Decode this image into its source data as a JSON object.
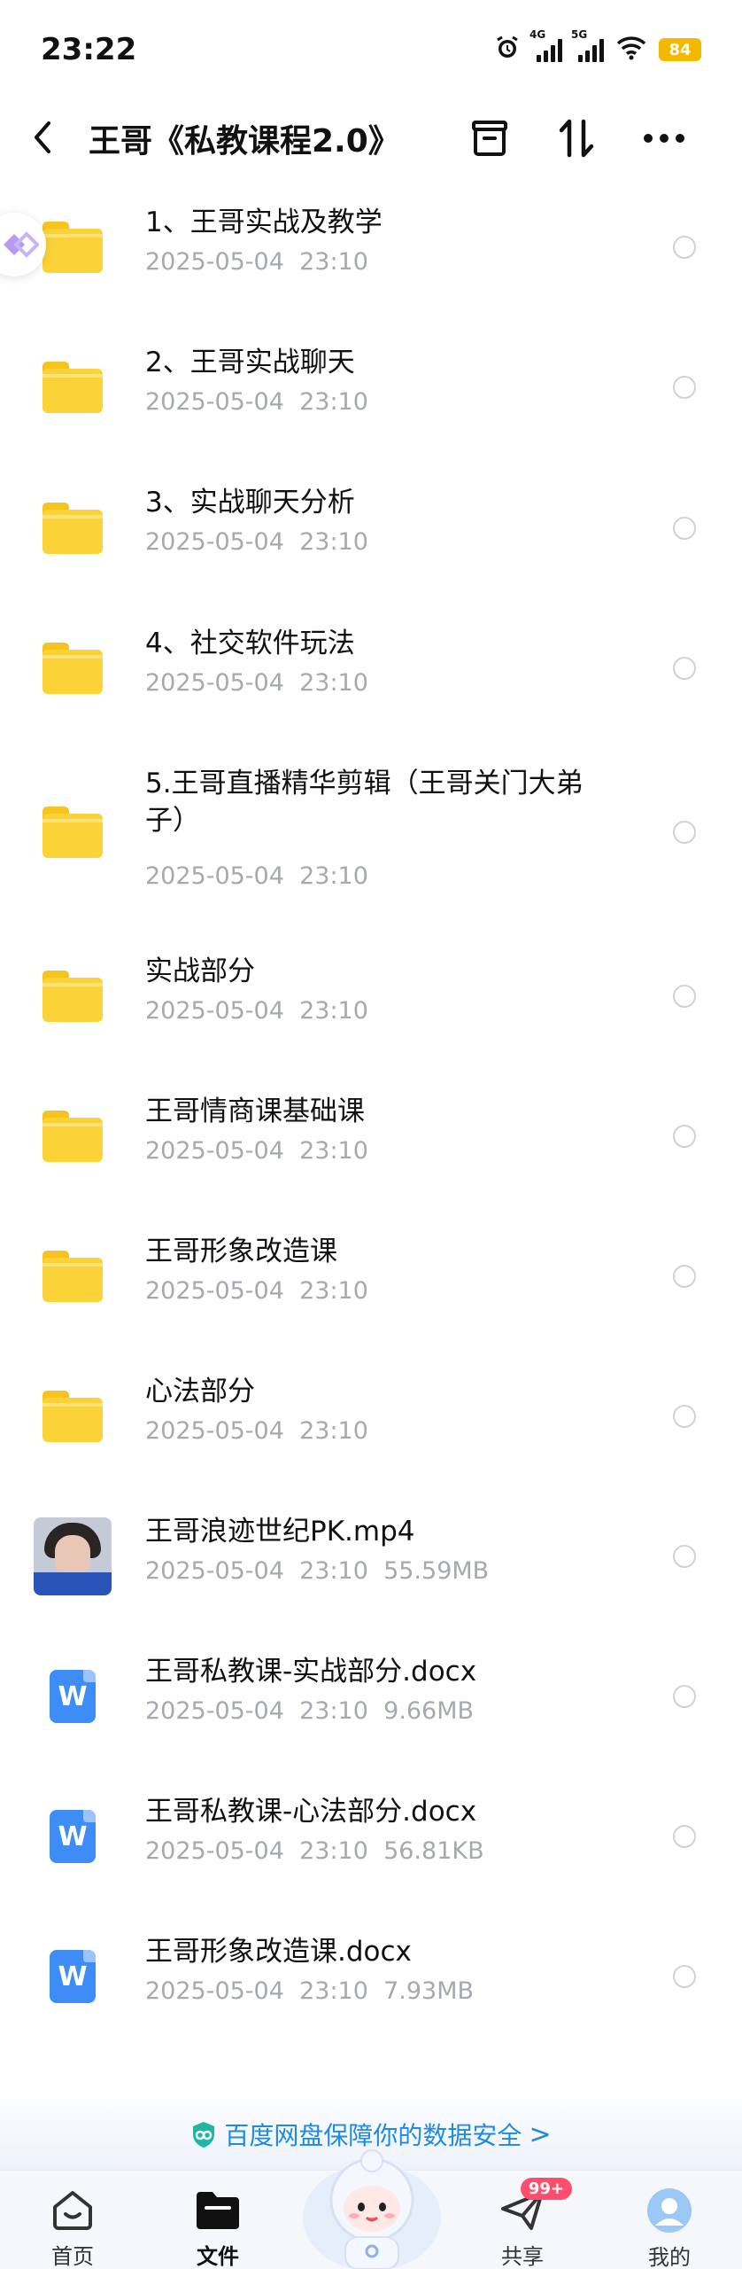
{
  "status_bar": {
    "time": "23:22",
    "network_1": "4G",
    "network_2": "5G",
    "battery": "84",
    "icons": [
      "alarm-icon",
      "signal-icon",
      "signal-icon",
      "wifi-icon",
      "battery-icon"
    ]
  },
  "header": {
    "title": "王哥《私教课程2.0》",
    "icons": [
      "back-icon",
      "archive-icon",
      "sort-icon",
      "more-icon"
    ]
  },
  "files": [
    {
      "type": "folder",
      "name": "1、王哥实战及教学",
      "date": "2025-05-04",
      "time": "23:10",
      "size": ""
    },
    {
      "type": "folder",
      "name": "2、王哥实战聊天",
      "date": "2025-05-04",
      "time": "23:10",
      "size": ""
    },
    {
      "type": "folder",
      "name": "3、实战聊天分析",
      "date": "2025-05-04",
      "time": "23:10",
      "size": ""
    },
    {
      "type": "folder",
      "name": "4、社交软件玩法",
      "date": "2025-05-04",
      "time": "23:10",
      "size": ""
    },
    {
      "type": "folder",
      "name": "5.王哥直播精华剪辑（王哥关门大弟子）",
      "date": "2025-05-04",
      "time": "23:10",
      "size": ""
    },
    {
      "type": "folder",
      "name": "实战部分",
      "date": "2025-05-04",
      "time": "23:10",
      "size": ""
    },
    {
      "type": "folder",
      "name": "王哥情商课基础课",
      "date": "2025-05-04",
      "time": "23:10",
      "size": ""
    },
    {
      "type": "folder",
      "name": "王哥形象改造课",
      "date": "2025-05-04",
      "time": "23:10",
      "size": ""
    },
    {
      "type": "folder",
      "name": "心法部分",
      "date": "2025-05-04",
      "time": "23:10",
      "size": ""
    },
    {
      "type": "video",
      "name": "王哥浪迹世纪PK.mp4",
      "date": "2025-05-04",
      "time": "23:10",
      "size": "55.59MB"
    },
    {
      "type": "doc",
      "name": "王哥私教课-实战部分.docx",
      "date": "2025-05-04",
      "time": "23:10",
      "size": "9.66MB"
    },
    {
      "type": "doc",
      "name": "王哥私教课-心法部分.docx",
      "date": "2025-05-04",
      "time": "23:10",
      "size": "56.81KB"
    },
    {
      "type": "doc",
      "name": "王哥形象改造课.docx",
      "date": "2025-05-04",
      "time": "23:10",
      "size": "7.93MB"
    }
  ],
  "doc_icon_letter": "W",
  "security_banner": {
    "text": "百度网盘保障你的数据安全",
    "chevron": ">"
  },
  "bottom_nav": {
    "items": [
      {
        "label": "首页",
        "icon": "home-icon"
      },
      {
        "label": "文件",
        "icon": "folder-icon"
      },
      {
        "label": "共享",
        "icon": "share-icon",
        "badge": "99+"
      },
      {
        "label": "我的",
        "icon": "avatar-icon"
      }
    ],
    "active": "文件"
  },
  "colors": {
    "folder": "#fbd338",
    "doc": "#3e8cf5",
    "accent": "#1e8be0",
    "badge": "#ff4d6d",
    "battery": "#f5b800"
  }
}
